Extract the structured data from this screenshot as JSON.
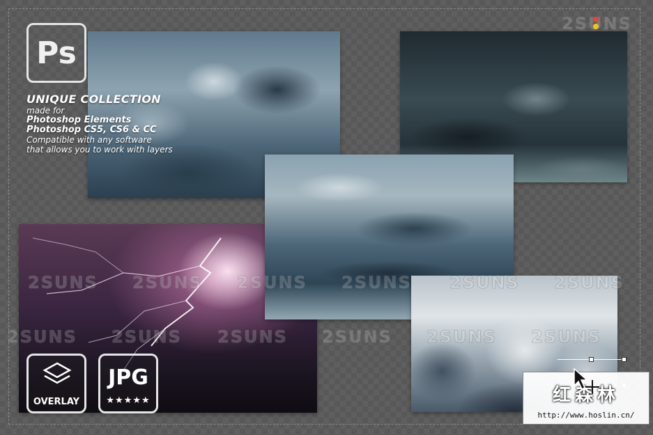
{
  "brand_watermark": "2SUNS",
  "ps_logo": {
    "label": "Ps"
  },
  "info": {
    "heading": "UNIQUE COLLECTION",
    "made_for": "made for",
    "product1": "Photoshop Elements",
    "product2": "Photoshop CS5, CS6 & CC",
    "compat1": "Compatible with any software",
    "compat2": "that allows you to work with layers"
  },
  "badges": {
    "overlay_caption": "OVERLAY",
    "jpg_label": "JPG",
    "stars": "★★★★★"
  },
  "site_overlay": {
    "cn_name": "红森林",
    "url": "http://www.hoslin.cn/"
  },
  "icons": [
    "layers-icon",
    "star-icon",
    "cursor-icon",
    "move-icon"
  ],
  "colors": {
    "watermark_dot_red": "#e0463a",
    "watermark_dot_yellow": "#f2c418"
  }
}
